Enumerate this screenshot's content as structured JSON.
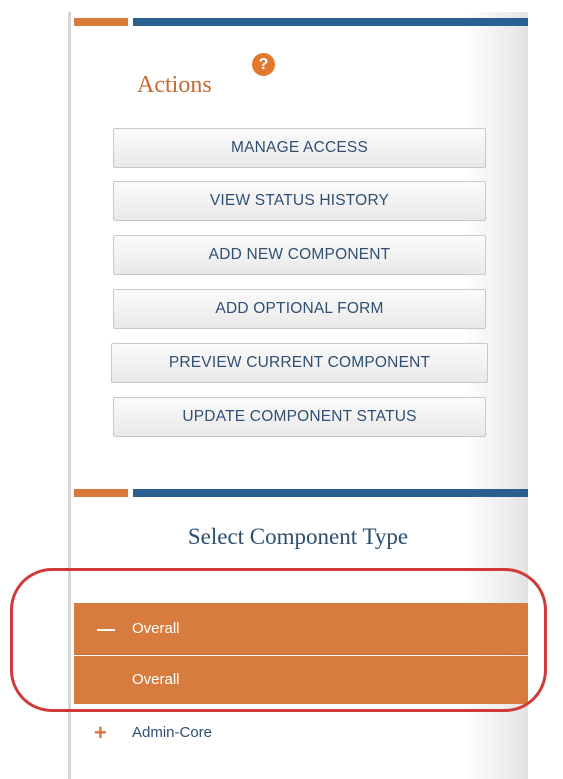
{
  "actions": {
    "title": "Actions",
    "help_icon_glyph": "?",
    "buttons": [
      {
        "label": "MANAGE ACCESS"
      },
      {
        "label": "VIEW STATUS HISTORY"
      },
      {
        "label": "ADD NEW COMPONENT"
      },
      {
        "label": "ADD OPTIONAL FORM"
      },
      {
        "label": "PREVIEW CURRENT COMPONENT"
      },
      {
        "label": "UPDATE COMPONENT STATUS"
      }
    ]
  },
  "components": {
    "title": "Select Component Type",
    "groups": [
      {
        "label": "Overall",
        "expanded": true,
        "toggle_glyph": "—",
        "children": [
          {
            "label": "Overall",
            "selected": true
          }
        ]
      },
      {
        "label": "Admin-Core",
        "expanded": false,
        "toggle_glyph": "+"
      }
    ]
  },
  "colors": {
    "accent_orange": "#d77c3e",
    "header_blue": "#2a5f92",
    "highlight_red": "#d23a3a"
  }
}
